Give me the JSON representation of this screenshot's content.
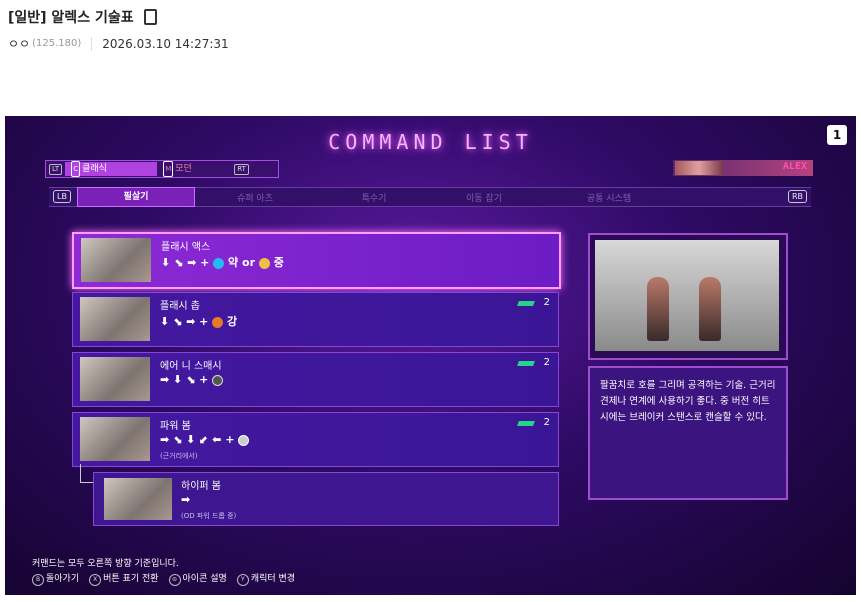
{
  "post": {
    "title": "[일반] 알렉스 기술표",
    "author": "ㅇㅇ",
    "ip": "(125.180)",
    "datetime": "2026.03.10 14:27:31"
  },
  "game": {
    "title": "COMMAND LIST",
    "page": "1",
    "mode_bar": {
      "left_key": "LT",
      "right_key": "RT",
      "classic_letter": "C",
      "classic": "클래식",
      "modern_letter": "M",
      "modern": "모던"
    },
    "character": "ALEX",
    "tabs": {
      "left_key": "LB",
      "right_key": "RB",
      "items": [
        "필살기",
        "슈퍼 아츠",
        "특수기",
        "이동 잡기",
        "공통 시스템"
      ]
    },
    "moves": [
      {
        "name": "플래시 액스",
        "cmd_arrows": "⬇ ⬊ ➡ +",
        "strength_a": "약",
        "or": "or",
        "strength_b": "중",
        "note": "",
        "count": ""
      },
      {
        "name": "플래시 촙",
        "cmd_arrows": "⬇ ⬊ ➡ +",
        "strength_a": "강",
        "note": "",
        "count": "2"
      },
      {
        "name": "에어 니 스매시",
        "cmd_arrows": "➡ ⬇ ⬊ +",
        "note": "",
        "count": "2"
      },
      {
        "name": "파워 봄",
        "cmd_arrows": "➡ ⬊ ⬇ ⬋ ⬅ +",
        "note": "(근거리에서)",
        "count": "2"
      }
    ],
    "submove": {
      "name": "하이퍼 봄",
      "cmd_arrows": "➡",
      "note": "(OD 파워 드롭 중)"
    },
    "description": "팔꿈치로 호를 그리며 공격하는 기술. 근거리 견제나 연계에 사용하기 좋다. 중 버전 히트 시에는 브레이커 스탠스로 캔슬할 수 있다.",
    "footer": {
      "note": "커맨드는 모두 오른쪽 방향 기준입니다.",
      "actions": [
        {
          "key": "B",
          "label": "돌아가기"
        },
        {
          "key": "X",
          "label": "버튼 표기 전환"
        },
        {
          "key": "⊜",
          "label": "아이콘 설명"
        },
        {
          "key": "Y",
          "label": "캐릭터 변경"
        }
      ]
    }
  }
}
